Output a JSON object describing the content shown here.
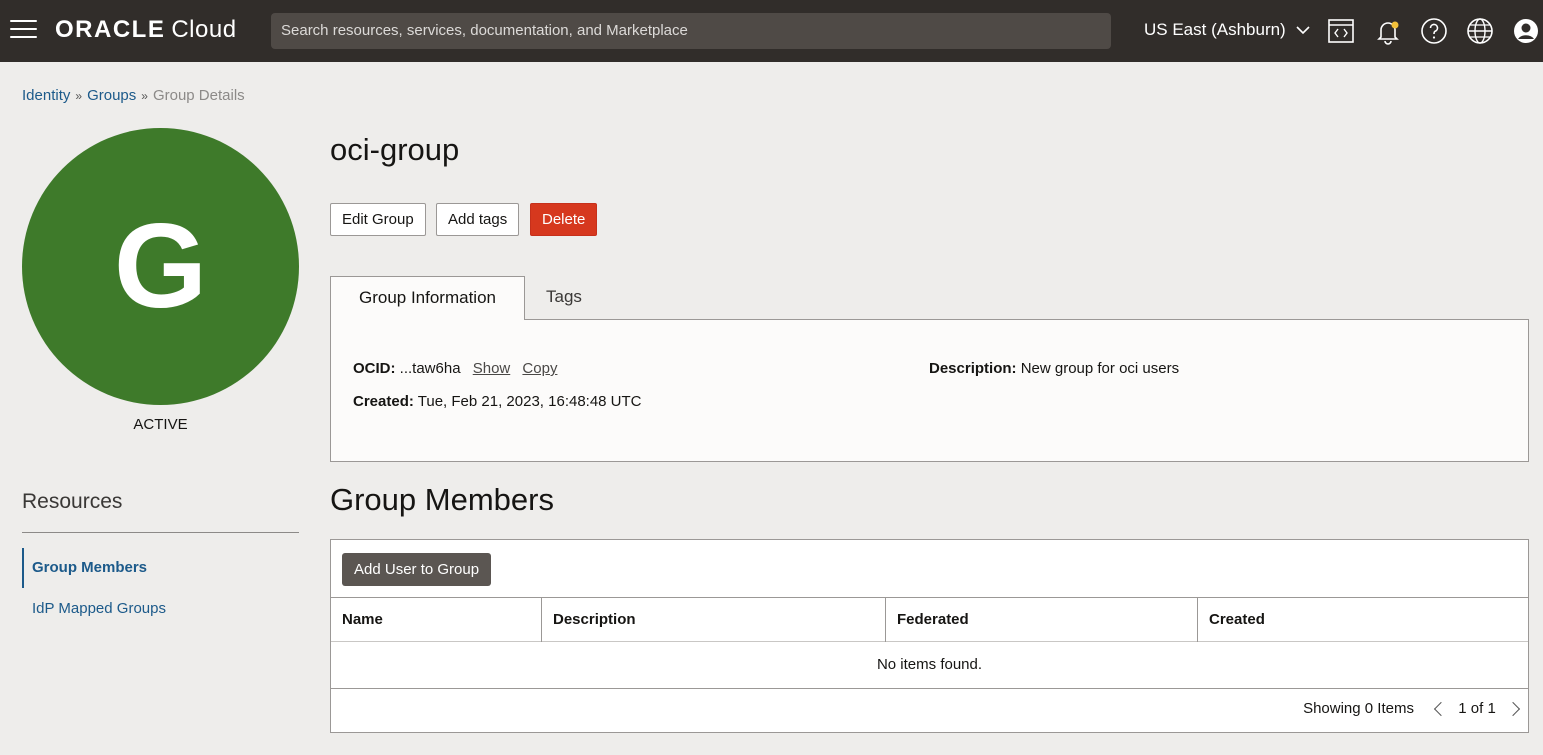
{
  "header": {
    "brand": "ORACLE",
    "product": "Cloud",
    "search_placeholder": "Search resources, services, documentation, and Marketplace",
    "region": "US East (Ashburn)"
  },
  "breadcrumb": {
    "items": [
      "Identity",
      "Groups"
    ],
    "current": "Group Details",
    "separator": "»"
  },
  "avatar": {
    "letter": "G",
    "color": "#3e7a2a",
    "status": "ACTIVE"
  },
  "resources": {
    "title": "Resources",
    "items": [
      {
        "label": "Group Members",
        "active": true
      },
      {
        "label": "IdP Mapped Groups",
        "active": false
      }
    ]
  },
  "group": {
    "name": "oci-group",
    "actions": {
      "edit": "Edit Group",
      "add_tags": "Add tags",
      "delete": "Delete"
    },
    "tabs": [
      "Group Information",
      "Tags"
    ],
    "info": {
      "ocid_label": "OCID:",
      "ocid_value": "...taw6ha",
      "show_link": "Show",
      "copy_link": "Copy",
      "created_label": "Created:",
      "created_value": "Tue, Feb 21, 2023, 16:48:48 UTC",
      "description_label": "Description:",
      "description_value": "New group for oci users"
    }
  },
  "members": {
    "title": "Group Members",
    "add_button": "Add User to Group",
    "columns": [
      "Name",
      "Description",
      "Federated",
      "Created"
    ],
    "empty_text": "No items found.",
    "showing": "Showing 0 Items",
    "pagination": "1 of 1"
  },
  "colors": {
    "topbar": "#312d2a",
    "link": "#1c5a8a",
    "danger": "#d6381e"
  }
}
